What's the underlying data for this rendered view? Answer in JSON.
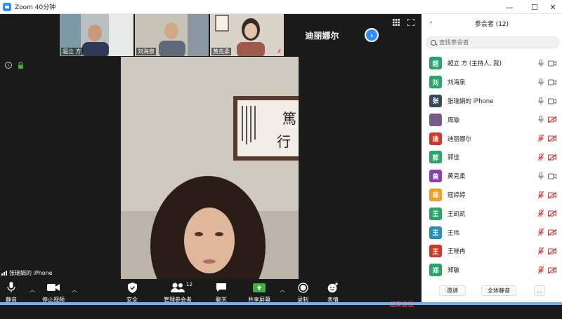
{
  "window": {
    "title": "Zoom 40分钟"
  },
  "thumbnails": [
    {
      "name": "超立 方"
    },
    {
      "name": "刘海泉"
    },
    {
      "name": "黄克柔"
    },
    {
      "name": "迪丽娜尔"
    }
  ],
  "speaker": {
    "name": "张瑞娟的 iPhone"
  },
  "toolbar": {
    "mute": "静音",
    "stop_video": "停止视频",
    "security": "安全",
    "participants": "管理参会者",
    "participants_count": "12",
    "chat": "聊天",
    "share": "共享屏幕",
    "record": "录制",
    "reactions": "表情",
    "end": "结束会议"
  },
  "panel": {
    "title": "参会者 (12)",
    "search_placeholder": "查找参会者",
    "participants": [
      {
        "initial": "超",
        "name": "超立 方 (主持人, 我)",
        "color": "#29a56b",
        "mic": "on",
        "cam": "on"
      },
      {
        "initial": "刘",
        "name": "刘海泉",
        "color": "#29a56b",
        "mic": "on",
        "cam": "on"
      },
      {
        "initial": "张",
        "name": "张瑞娟的 iPhone",
        "color": "#344a5e",
        "mic": "on",
        "cam": "on"
      },
      {
        "initial": "",
        "name": "周璇",
        "color": "#7a5a8a",
        "mic": "on",
        "cam": "off"
      },
      {
        "initial": "迪",
        "name": "迪丽娜尔",
        "color": "#d13a2a",
        "mic": "off",
        "cam": "off"
      },
      {
        "initial": "郭",
        "name": "郭佳",
        "color": "#29a56b",
        "mic": "off",
        "cam": "off"
      },
      {
        "initial": "黄",
        "name": "黄克柔",
        "color": "#8b3fb0",
        "mic": "on",
        "cam": "on"
      },
      {
        "initial": "寇",
        "name": "寇婷婷",
        "color": "#f0a020",
        "mic": "off",
        "cam": "off"
      },
      {
        "initial": "王",
        "name": "王凯凯",
        "color": "#29a56b",
        "mic": "off",
        "cam": "off"
      },
      {
        "initial": "王",
        "name": "王伟",
        "color": "#2a8fb8",
        "mic": "off",
        "cam": "off"
      },
      {
        "initial": "王",
        "name": "王晓冉",
        "color": "#d13a2a",
        "mic": "off",
        "cam": "off"
      },
      {
        "initial": "郑",
        "name": "郑敏",
        "color": "#29a56b",
        "mic": "off",
        "cam": "off"
      }
    ],
    "invite": "邀请",
    "mute_all": "全体静音",
    "more": "..."
  }
}
